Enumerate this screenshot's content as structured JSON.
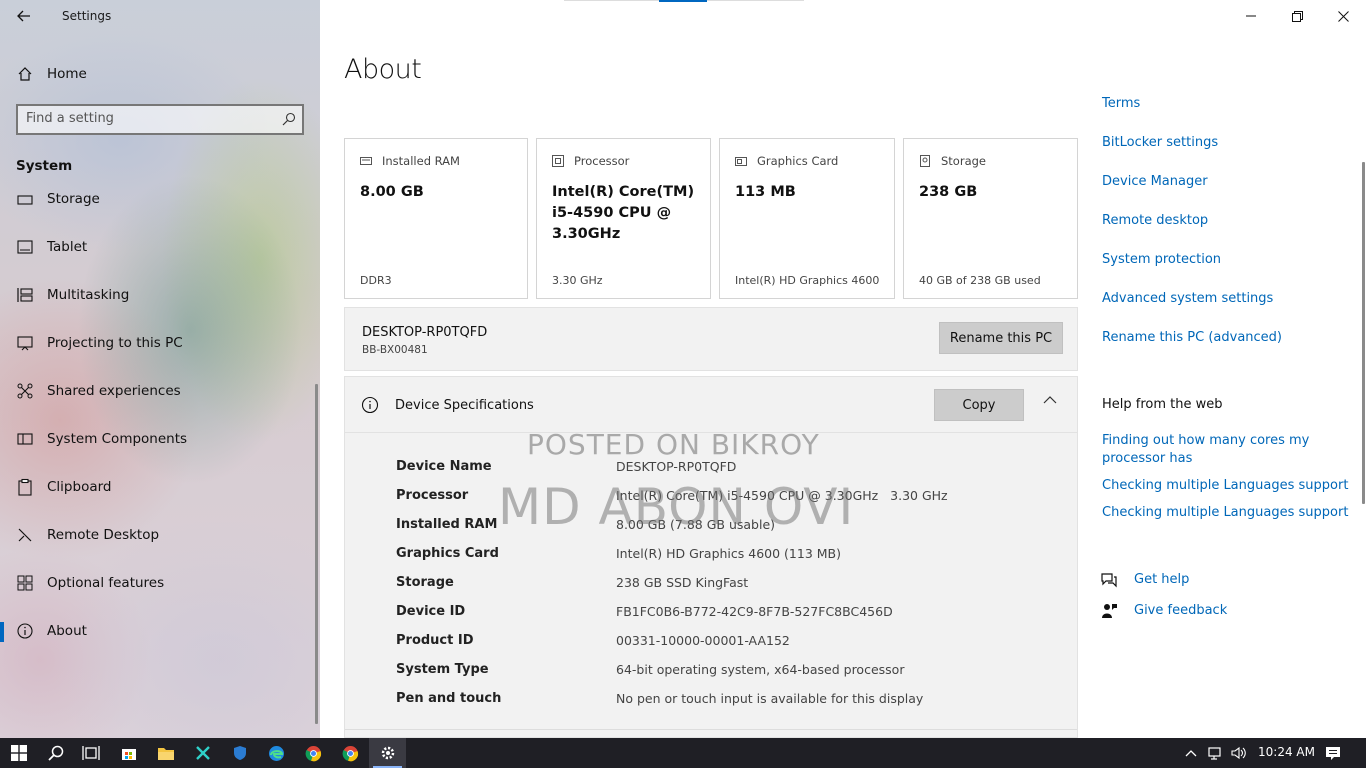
{
  "window": {
    "title": "Settings",
    "controls": [
      "minimize",
      "restore",
      "close"
    ]
  },
  "sidebar": {
    "home_label": "Home",
    "search_placeholder": "Find a setting",
    "section_title": "System",
    "items": [
      {
        "label": "Storage",
        "icon": "storage-icon"
      },
      {
        "label": "Tablet",
        "icon": "tablet-icon"
      },
      {
        "label": "Multitasking",
        "icon": "multitasking-icon"
      },
      {
        "label": "Projecting to this PC",
        "icon": "projecting-icon"
      },
      {
        "label": "Shared experiences",
        "icon": "shared-experiences-icon"
      },
      {
        "label": "System Components",
        "icon": "system-components-icon"
      },
      {
        "label": "Clipboard",
        "icon": "clipboard-icon"
      },
      {
        "label": "Remote Desktop",
        "icon": "remote-desktop-icon"
      },
      {
        "label": "Optional features",
        "icon": "optional-features-icon"
      },
      {
        "label": "About",
        "icon": "info-icon",
        "active": true
      }
    ]
  },
  "main": {
    "title": "About",
    "cards": [
      {
        "label": "Installed RAM",
        "value": "8.00 GB",
        "sub": "DDR3",
        "icon": "ram-icon"
      },
      {
        "label": "Processor",
        "value": "Intel(R) Core(TM) i5-4590 CPU @ 3.30GHz",
        "sub": "3.30 GHz",
        "icon": "processor-icon"
      },
      {
        "label": "Graphics Card",
        "value": "113 MB",
        "sub": "Intel(R) HD Graphics 4600",
        "icon": "graphics-card-icon"
      },
      {
        "label": "Storage",
        "value": "238 GB",
        "sub": "40 GB of 238 GB used",
        "icon": "storage-drive-icon"
      }
    ],
    "pc": {
      "name": "DESKTOP-RP0TQFD",
      "model": "BB-BX00481",
      "rename_label": "Rename this PC"
    },
    "device_specs": {
      "header": "Device Specifications",
      "copy_label": "Copy",
      "rows": [
        {
          "key": "Device Name",
          "value": "DESKTOP-RP0TQFD"
        },
        {
          "key": "Processor",
          "value": "Intel(R) Core(TM) i5-4590 CPU @ 3.30GHz   3.30 GHz"
        },
        {
          "key": "Installed RAM",
          "value": "8.00 GB (7.88 GB usable)"
        },
        {
          "key": "Graphics Card",
          "value": "Intel(R) HD Graphics 4600 (113 MB)"
        },
        {
          "key": "Storage",
          "value": "238 GB SSD KingFast"
        },
        {
          "key": "Device ID",
          "value": "FB1FC0B6-B772-42C9-8F7B-527FC8BC456D"
        },
        {
          "key": "Product ID",
          "value": "00331-10000-00001-AA152"
        },
        {
          "key": "System Type",
          "value": "64-bit operating system, x64-based processor"
        },
        {
          "key": "Pen and touch",
          "value": "No pen or touch input is available for this display"
        }
      ]
    },
    "watermark": {
      "line1": "POSTED ON BIKROY",
      "line2": "MD ABON OVI"
    }
  },
  "right_panel": {
    "links": [
      "Terms",
      "BitLocker settings",
      "Device Manager",
      "Remote desktop",
      "System protection",
      "Advanced system settings",
      "Rename this PC (advanced)"
    ],
    "help_heading": "Help from the web",
    "help_links": [
      "Finding out how many cores my processor has",
      "Checking multiple Languages support",
      "Checking multiple Languages support"
    ],
    "get_help": "Get help",
    "give_feedback": "Give feedback"
  },
  "taskbar": {
    "apps": [
      "start",
      "search",
      "task-view",
      "store",
      "file-explorer",
      "app-x",
      "security",
      "edge",
      "chrome",
      "chrome",
      "settings"
    ],
    "clock": "10:24 AM",
    "colors": {
      "background": "#1f1f25",
      "accent": "#0067c0",
      "link": "#0067b8"
    }
  }
}
